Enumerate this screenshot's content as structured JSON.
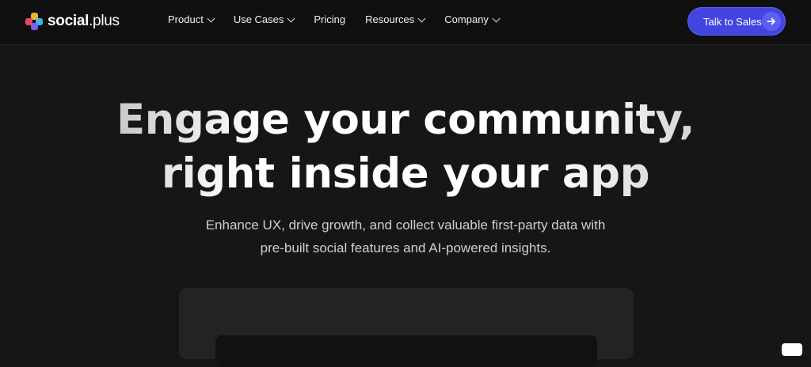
{
  "brand": {
    "name_bold": "social",
    "name_thin": ".plus"
  },
  "nav": {
    "items": [
      {
        "label": "Product",
        "dropdown": true
      },
      {
        "label": "Use Cases",
        "dropdown": true
      },
      {
        "label": "Pricing",
        "dropdown": false
      },
      {
        "label": "Resources",
        "dropdown": true
      },
      {
        "label": "Company",
        "dropdown": true
      }
    ],
    "cta_label": "Talk to Sales"
  },
  "hero": {
    "title_line1": "Engage your community,",
    "title_line2": "right inside your app",
    "subtitle_line1": "Enhance UX, drive growth, and collect valuable first-party data with",
    "subtitle_line2": "pre-built social features and AI-powered insights."
  },
  "colors": {
    "background": "#161616",
    "nav_background": "#101010",
    "accent": "#4345e0",
    "logo_colors": [
      "#f0b429",
      "#e8475f",
      "#3fb6f0",
      "#7d5cf5"
    ]
  },
  "icons": [
    "logo-mark-icon",
    "chevron-down-icon",
    "arrow-right-icon"
  ]
}
